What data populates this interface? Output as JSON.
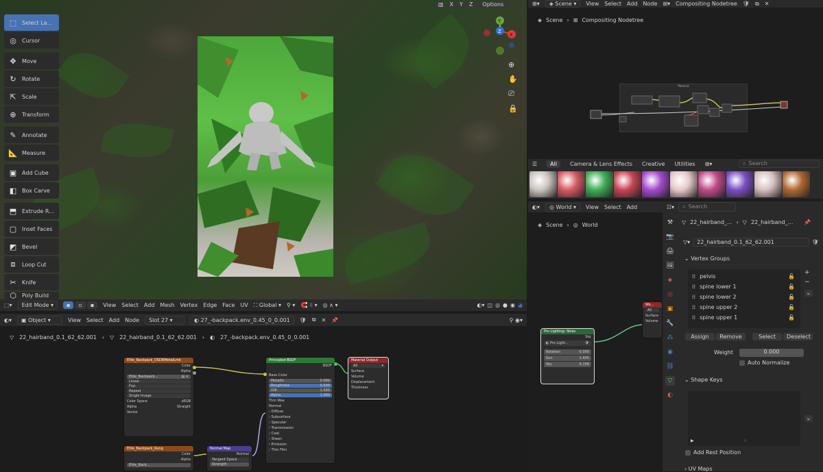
{
  "viewport": {
    "top_right": {
      "options_label": "Options",
      "axes": [
        "X",
        "Y",
        "Z"
      ]
    },
    "tools": [
      {
        "label": "Select La...",
        "icon": "select-box-icon",
        "active": true
      },
      {
        "label": "Cursor",
        "icon": "cursor-icon"
      },
      {
        "label": "Move",
        "icon": "move-icon"
      },
      {
        "label": "Rotate",
        "icon": "rotate-icon"
      },
      {
        "label": "Scale",
        "icon": "scale-icon"
      },
      {
        "label": "Transform",
        "icon": "transform-icon"
      },
      {
        "label": "Annotate",
        "icon": "annotate-icon"
      },
      {
        "label": "Measure",
        "icon": "measure-icon"
      },
      {
        "label": "Add Cube",
        "icon": "add-cube-icon"
      },
      {
        "label": "Box Carve",
        "icon": "box-carve-icon"
      },
      {
        "label": "Extrude R...",
        "icon": "extrude-icon"
      },
      {
        "label": "Inset Faces",
        "icon": "inset-faces-icon"
      },
      {
        "label": "Bevel",
        "icon": "bevel-icon"
      },
      {
        "label": "Loop Cut",
        "icon": "loop-cut-icon"
      },
      {
        "label": "Knife",
        "icon": "knife-icon"
      },
      {
        "label": "Poly Build",
        "icon": "poly-build-icon"
      }
    ],
    "gizmo": {
      "y": "Y",
      "x": "X",
      "z": "Z"
    },
    "header": {
      "mode": "Edit Mode",
      "menus": [
        "View",
        "Select",
        "Add",
        "Mesh",
        "Vertex",
        "Edge",
        "Face",
        "UV"
      ],
      "orientation": "Global"
    }
  },
  "shader_editor": {
    "header": {
      "type": "Object",
      "menus": [
        "View",
        "Select",
        "Add",
        "Node"
      ],
      "slot": "Slot 27",
      "material": "27_-backpack.env_0.45_0_0.001"
    },
    "breadcrumb": [
      "22_hairband_0.1_62_62.001",
      "22_hairband_0.1_62_62.001",
      "27_-backpack.env_0.45_0_0.001"
    ],
    "img_node": {
      "title": "Elite_Backpack_DSDRMetalLmk",
      "out1": "Color",
      "out2": "Alpha",
      "file": "Elite_Backpack...",
      "fields": [
        "Linear",
        "Flat",
        "Repeat",
        "Single Image"
      ],
      "cs_label": "Color Space",
      "cs_value": "sRGB",
      "alpha_label": "Alpha",
      "alpha_value": "Straight",
      "vector": "Vector"
    },
    "img_node2": {
      "title": "Elite_Backpack_Rung",
      "out1": "Color",
      "out2": "Alpha",
      "file": "Elite_Back..."
    },
    "normal_node": {
      "title": "Normal Map",
      "out": "Normal",
      "field": "Tangent Space",
      "field2": "Strength"
    },
    "bsdf": {
      "title": "Principled BSDF",
      "out": "BSDF",
      "rows": [
        [
          "Base Color",
          ""
        ],
        [
          "Metallic",
          "0.000"
        ],
        [
          "Roughness",
          "0.500"
        ],
        [
          "IOR",
          "1.500"
        ],
        [
          "Alpha",
          "1.000"
        ]
      ],
      "sub": [
        "Thin Wax",
        "Normal",
        "Diffuse",
        "Subsurface",
        "Specular",
        "Transmission",
        "Coat",
        "Sheen",
        "Emission",
        "Thin Film"
      ]
    },
    "output": {
      "title": "Material Output",
      "target": "All",
      "inputs": [
        "Surface",
        "Volume",
        "Displacement",
        "Thickness"
      ]
    }
  },
  "compositor": {
    "header": {
      "scene": "Scene",
      "menus": [
        "View",
        "Select",
        "Add",
        "Node"
      ],
      "tree": "Compositing Nodetree"
    },
    "breadcrumb": [
      "Scene",
      "Compositing Nodetree"
    ],
    "frame_label": "Material"
  },
  "asset_browser": {
    "tabs": [
      "All",
      "Camera & Lens Effects",
      "Creative",
      "Utilities"
    ],
    "search_placeholder": "Search",
    "swatches": [
      "#c9c4bd",
      "#d65a62",
      "#3fae57",
      "#c84454",
      "#a44ad0",
      "#e4c8c6",
      "#c04a88",
      "#7a4fc1",
      "#d6bfbf",
      "#b06830"
    ]
  },
  "world_editor": {
    "header": {
      "type": "World",
      "menus": [
        "View",
        "Select",
        "Add"
      ]
    },
    "breadcrumb": [
      "Scene",
      "World"
    ],
    "node": {
      "title": "Pro Lighting: Skies",
      "out": "Sky",
      "dropdown": "Pro Light...",
      "rows": [
        [
          "Rotation",
          "-5.000"
        ],
        [
          "Sun",
          "1.405"
        ],
        [
          "Sky",
          "6.199"
        ]
      ]
    },
    "out_node": {
      "title": "Wo...",
      "target": "All",
      "inputs": [
        "Surface",
        "Volume"
      ]
    }
  },
  "properties": {
    "search_placeholder": "Search",
    "breadcrumb": [
      "22_hairband_...",
      "22_hairband_..."
    ],
    "mesh_name": "22_hairband_0.1_62_62.001",
    "vertex_groups_title": "Vertex Groups",
    "vertex_groups": [
      "pelvis",
      "spine lower 1",
      "spine lower 2",
      "spine upper 2",
      "spine upper 1"
    ],
    "buttons": [
      "Assign",
      "Remove",
      "Select",
      "Deselect"
    ],
    "weight_label": "Weight",
    "weight_value": "0.000",
    "auto_normalize": "Auto Normalize",
    "shape_keys_title": "Shape Keys",
    "add_rest": "Add Rest Position",
    "uv_maps_title": "UV Maps"
  }
}
